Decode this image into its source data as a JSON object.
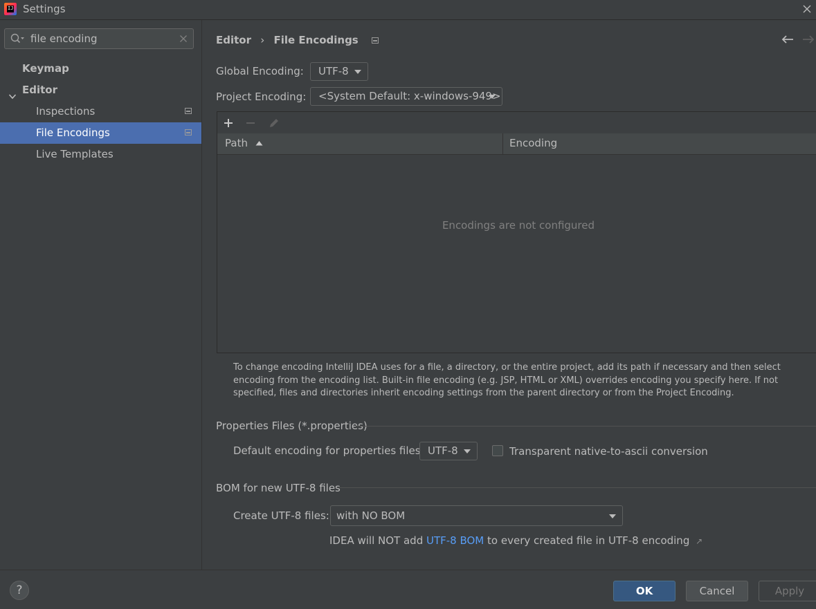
{
  "window": {
    "title": "Settings"
  },
  "sidebar": {
    "search_value": "file encoding",
    "items": [
      {
        "label": "Keymap"
      },
      {
        "label": "Editor"
      },
      {
        "label": "Inspections"
      },
      {
        "label": "File Encodings",
        "selected": true
      },
      {
        "label": "Live Templates"
      }
    ]
  },
  "breadcrumb": {
    "parent": "Editor",
    "current": "File Encodings"
  },
  "global_encoding": {
    "label": "Global Encoding:",
    "value": "UTF-8"
  },
  "project_encoding": {
    "label": "Project Encoding:",
    "value": "<System Default: x-windows-949>"
  },
  "table": {
    "columns": [
      "Path",
      "Encoding"
    ],
    "empty_text": "Encodings are not configured"
  },
  "help_text": "To change encoding IntelliJ IDEA uses for a file, a directory, or the entire project, add its path if necessary and then select encoding from the encoding list. Built-in file encoding (e.g. JSP, HTML or XML) overrides encoding you specify here. If not specified, files and directories inherit encoding settings from the parent directory or from the Project Encoding.",
  "properties": {
    "section_title": "Properties Files (*.properties)",
    "default_label": "Default encoding for properties files:",
    "default_value": "UTF-8",
    "checkbox_label": "Transparent native-to-ascii conversion",
    "checkbox_checked": false
  },
  "bom": {
    "section_title": "BOM for new UTF-8 files",
    "create_label": "Create UTF-8 files:",
    "create_value": "with NO BOM",
    "note_prefix": "IDEA will NOT add ",
    "note_link": "UTF-8 BOM",
    "note_suffix": " to every created file in UTF-8 encoding",
    "note_arrow": "↗"
  },
  "buttons": {
    "help": "?",
    "ok": "OK",
    "cancel": "Cancel",
    "apply": "Apply"
  },
  "colors": {
    "selection": "#4b6eaf",
    "link": "#589df6",
    "ok_button": "#365880"
  }
}
